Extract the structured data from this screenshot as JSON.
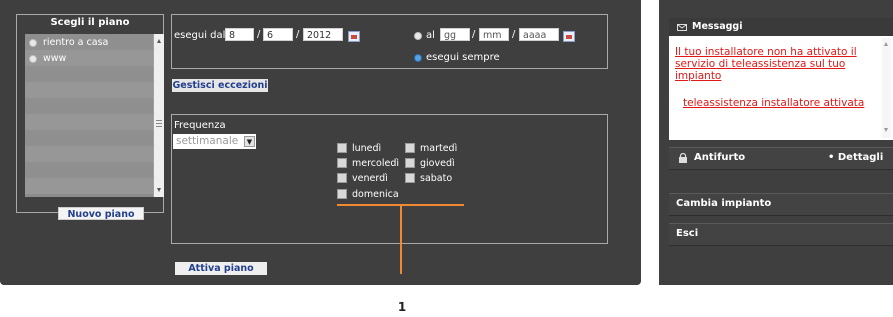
{
  "plan_selector": {
    "title": "Scegli il piano",
    "items": [
      "rientro a casa",
      "www"
    ],
    "new_plan_label": "Nuovo piano"
  },
  "run": {
    "from_label": "esegui dal",
    "from_day": "8",
    "from_month": "6",
    "from_year": "2012",
    "separator": "/",
    "to_label": "al",
    "to_day_placeholder": "gg",
    "to_month_placeholder": "mm",
    "to_year_placeholder": "aaaa",
    "always_label": "esegui sempre"
  },
  "exceptions_label": "Gestisci eccezioni",
  "frequency": {
    "label": "Frequenza",
    "selected": "settimanale",
    "days": [
      "lunedì",
      "martedì",
      "mercoledì",
      "giovedì",
      "venerdì",
      "sabato",
      "domenica"
    ]
  },
  "activate_label": "Attiva piano",
  "callout": "1",
  "messages": {
    "title": "Messaggi",
    "items": [
      "Il tuo installatore non ha attivato il servizio di teleassistenza sul tuo impianto",
      "teleassistenza installatore attivata"
    ]
  },
  "antifurto": {
    "title": "Antifurto",
    "details": "• Dettagli"
  },
  "change_system_label": "Cambia impianto",
  "exit_label": "Esci",
  "colors": {
    "panel": "#3f3f3f",
    "message_text": "#e01818",
    "callout": "#f08a32",
    "button_text": "#23408e"
  }
}
